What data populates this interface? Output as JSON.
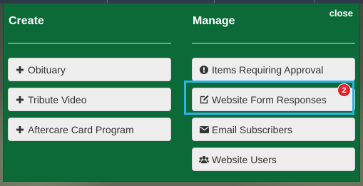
{
  "close_label": "close",
  "create": {
    "heading": "Create",
    "items": [
      {
        "label": "Obituary",
        "icon": "plus-icon"
      },
      {
        "label": "Tribute Video",
        "icon": "plus-icon"
      },
      {
        "label": "Aftercare Card Program",
        "icon": "plus-icon"
      }
    ]
  },
  "manage": {
    "heading": "Manage",
    "items": [
      {
        "label": "Items Requiring Approval",
        "icon": "exclamation-circle-icon"
      },
      {
        "label": "Website Form Responses",
        "icon": "edit-icon",
        "badge": "2"
      },
      {
        "label": "Email Subscribers",
        "icon": "envelope-icon"
      },
      {
        "label": "Website Users",
        "icon": "users-icon"
      }
    ]
  },
  "colors": {
    "panel": "#0c6a38",
    "highlight": "#2cb5e0",
    "badge": "#e0262c"
  }
}
